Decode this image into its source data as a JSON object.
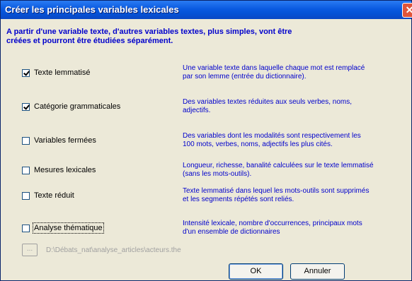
{
  "dialog": {
    "title": "Créer les principales variables lexicales",
    "close_glyph": "✕",
    "intro_line1": "A partir d'une variable texte, d'autres variables textes, plus simples, vont être",
    "intro_line2": "créées et pourront être étudiées séparément."
  },
  "options": [
    {
      "label": "Texte lemmatisé",
      "checked": true,
      "desc1": "Une variable texte dans laquelle chaque mot est remplacé",
      "desc2": "par son lemme (entrée du dictionnaire)."
    },
    {
      "label": "Catégorie grammaticales",
      "checked": true,
      "desc1": "Des variables textes réduites aux seuls verbes, noms,",
      "desc2": "adjectifs."
    },
    {
      "label": "Variables fermées",
      "checked": false,
      "desc1": "Des variables dont les modalités sont respectivement  les",
      "desc2": "100 mots, verbes, noms, adjectifs  les plus cités."
    },
    {
      "label": "Mesures lexicales",
      "checked": false,
      "desc1": "Longueur, richesse, banalité calculées sur le texte lemmatisé",
      "desc2": "(sans les mots-outils)."
    },
    {
      "label": "Texte réduit",
      "checked": false,
      "desc1": "Texte lemmatisé dans lequel les mots-outils sont supprimés",
      "desc2": "et les segments répétés sont reliés."
    },
    {
      "label": "Analyse thématique",
      "checked": false,
      "desc1": "Intensité lexicale, nombre d'occurrences, principaux mots",
      "desc2": "d'un ensemble de dictionnaires"
    }
  ],
  "browse": {
    "button_label": "...",
    "path": "D:\\Débats_nat\\analyse_articles\\acteurs.the"
  },
  "buttons": {
    "ok": "OK",
    "cancel": "Annuler"
  }
}
